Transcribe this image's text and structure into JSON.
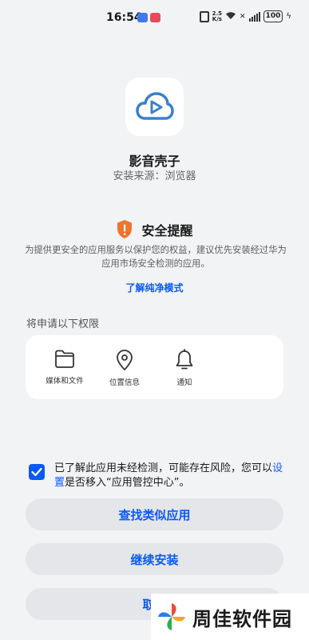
{
  "status_bar": {
    "time": "16:54",
    "speed_value": "2.5",
    "speed_unit": "K/s",
    "battery": "100"
  },
  "app": {
    "name": "影音壳子",
    "source": "安装来源：浏览器"
  },
  "security": {
    "title": "安全提醒",
    "description": "为提供更安全的应用服务以保护您的权益，建议优先安装经过华为应用市场安全检测的应用。",
    "learn_more": "了解纯净模式"
  },
  "permissions": {
    "heading": "将申请以下权限",
    "items": [
      {
        "label": "媒体和文件",
        "icon": "folder-icon"
      },
      {
        "label": "位置信息",
        "icon": "location-icon"
      },
      {
        "label": "通知",
        "icon": "bell-icon"
      }
    ]
  },
  "consent": {
    "checked": true,
    "text_before": "已了解此应用未经检测，可能存在风险，您可以",
    "link": "设置",
    "text_after": "是否移入“应用管控中心”。"
  },
  "buttons": {
    "find_similar": "查找类似应用",
    "continue_install": "继续安装",
    "cancel": "取消"
  },
  "watermark": {
    "text": "周佳软件园"
  },
  "colors": {
    "accent": "#0a59f7",
    "background": "#f1f3f5",
    "warning": "#f0742e",
    "app_icon": "#3a80c9"
  }
}
